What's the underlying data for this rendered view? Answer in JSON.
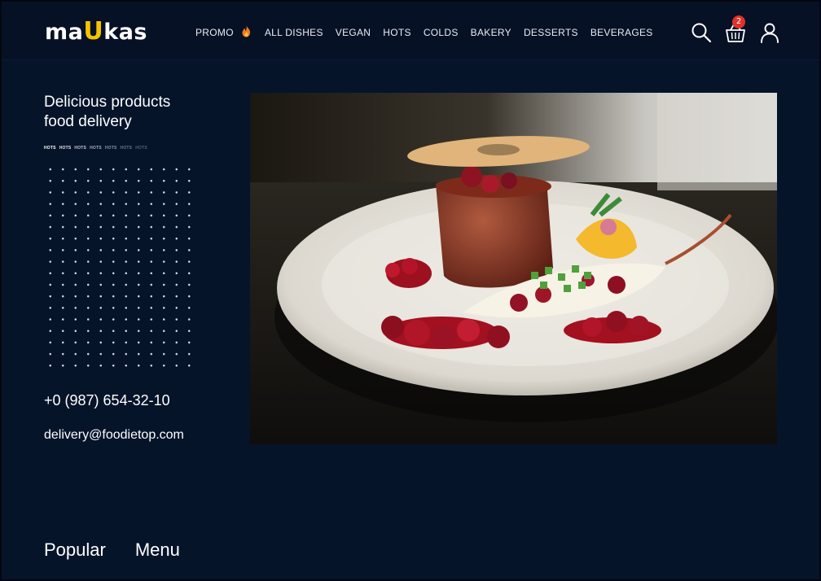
{
  "brand": {
    "logo_prefix": "ma",
    "logo_accent": "U",
    "logo_suffix": "kas",
    "accent_color": "#f5c400"
  },
  "nav": {
    "items": [
      {
        "label": "PROMO",
        "icon": "fire-icon"
      },
      {
        "label": "ALL DISHES"
      },
      {
        "label": "VEGAN"
      },
      {
        "label": "HOTS"
      },
      {
        "label": "COLDS"
      },
      {
        "label": "BAKERY"
      },
      {
        "label": "DESSERTS"
      },
      {
        "label": "BEVERAGES"
      }
    ]
  },
  "header_icons": {
    "search": "search-icon",
    "cart": "basket-icon",
    "cart_count": "2",
    "account": "user-icon",
    "badge_color": "#e0322a"
  },
  "hero": {
    "title_line1": "Delicious products",
    "title_line2": "food delivery",
    "tags": [
      "HOTS",
      "HOTS",
      "HOTS",
      "HOTS",
      "HOTS",
      "HOTS",
      "HOTS"
    ],
    "phone": "+0 (987) 654-32-10",
    "email": "delivery@foodietop.com",
    "image": "plated-dish-photo"
  },
  "bottom": {
    "popular_label": "Popular",
    "menu_label": "Menu"
  },
  "colors": {
    "background": "#061328",
    "header": "#071125",
    "text": "#ffffff"
  }
}
